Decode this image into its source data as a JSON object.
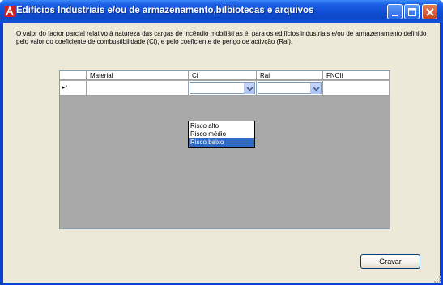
{
  "window": {
    "title": "Edifícios Industriais e/ou de armazenamento,bilbiotecas e arquivos",
    "icon": "app-logo-icon",
    "buttons": [
      "minimize-icon",
      "maximize-icon",
      "close-icon"
    ]
  },
  "description": "O valor do factor parcial relativo à natureza das cargas de incêndio mobiliáti as é, para os edifícios  industriais e/ou de armazenamento,definido pelo valor do coeficiente de combustibilidade (Ci), e pelo coeficiente de perigo de activção (Rai).",
  "grid": {
    "columns": [
      "Material",
      "Ci",
      "Rai",
      "FNCIi"
    ],
    "new_row_marker": "▸*",
    "row": {
      "material": "",
      "ci": "",
      "rai": "",
      "fncii": ""
    }
  },
  "dropdown": {
    "options": [
      "Risco alto",
      "Risco médio",
      "Risco baixo"
    ],
    "highlighted": "Risco baixo"
  },
  "buttons": {
    "save_label": "Gravar"
  },
  "colors": {
    "titlebar": "#0f4ed4",
    "client": "#ece9d8",
    "grid_background": "#a9a9a9",
    "selection": "#316ac5"
  }
}
